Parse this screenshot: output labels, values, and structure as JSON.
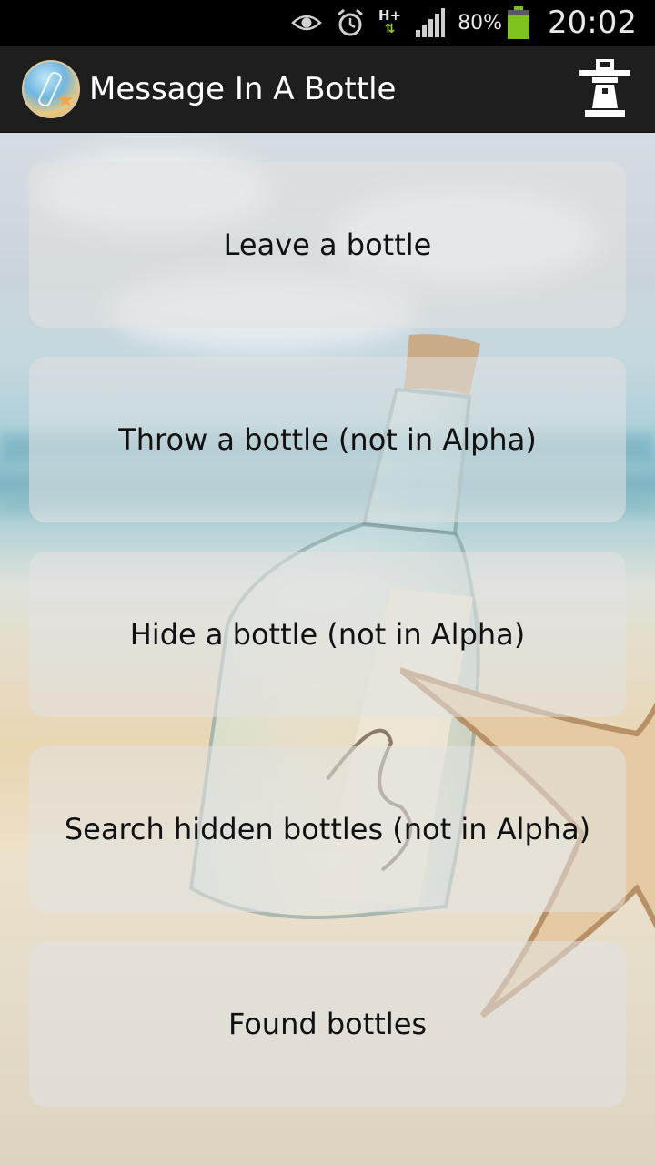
{
  "status_bar": {
    "network_type": "H+",
    "battery_percent": "80%",
    "time": "20:02"
  },
  "action_bar": {
    "title": "Message In A Bottle",
    "app_icon": "bottle-beach-icon",
    "right_icon": "lighthouse-icon"
  },
  "menu": {
    "items": [
      {
        "label": "Leave a bottle"
      },
      {
        "label": "Throw a bottle (not in Alpha)"
      },
      {
        "label": "Hide a bottle (not in Alpha)"
      },
      {
        "label": "Search hidden bottles (not in Alpha)"
      },
      {
        "label": "Found bottles"
      }
    ]
  },
  "colors": {
    "action_bar_bg": "#1e1e1e",
    "status_bar_bg": "#000000",
    "button_bg": "rgba(225,225,225,0.55)",
    "battery_green": "#7dc21e"
  }
}
